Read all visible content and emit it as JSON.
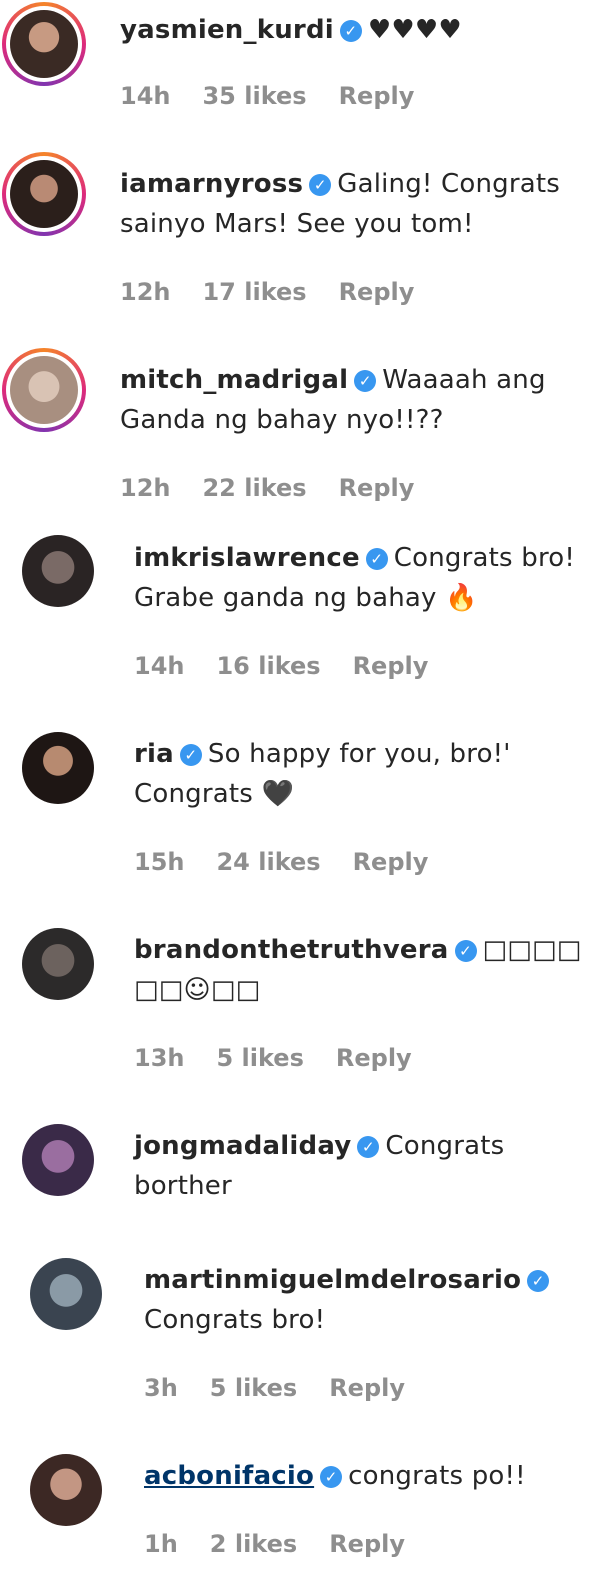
{
  "comments": [
    {
      "username": "yasmien_kurdi",
      "text": "♥♥♥♥",
      "time": "14h",
      "likes": "35 likes",
      "reply": "Reply"
    },
    {
      "username": "iamarnyross",
      "text": "Galing! Congrats sainyo Mars! See you tom!",
      "time": "12h",
      "likes": "17 likes",
      "reply": "Reply"
    },
    {
      "username": "mitch_madrigal",
      "text": "Waaaah ang Ganda ng bahay nyo!!??",
      "time": "12h",
      "likes": "22 likes",
      "reply": "Reply"
    },
    {
      "username": "imkrislawrence",
      "text": "Congrats bro! Grabe ganda ng bahay 🔥",
      "time": "14h",
      "likes": "16 likes",
      "reply": "Reply"
    },
    {
      "username": "ria",
      "text": "So happy for you, bro!' Congrats 🖤",
      "time": "15h",
      "likes": "24 likes",
      "reply": "Reply"
    },
    {
      "username": "brandonthetruthvera",
      "text": "□□□□ □□☺□□",
      "time": "13h",
      "likes": "5 likes",
      "reply": "Reply"
    },
    {
      "username": "jongmadaliday",
      "text": "Congrats borther",
      "time": "",
      "likes": "",
      "reply": ""
    },
    {
      "username": "martinmiguelmdelrosario",
      "text": "Congrats bro!",
      "time": "3h",
      "likes": "5 likes",
      "reply": "Reply"
    },
    {
      "username": "acbonifacio",
      "text": "congrats po!!",
      "time": "1h",
      "likes": "2 likes",
      "reply": "Reply"
    }
  ],
  "verified_icon": "verified-check-icon",
  "colors": {
    "accent_blue": "#3897f0",
    "meta_gray": "#8e8e8e",
    "link": "#003569"
  }
}
